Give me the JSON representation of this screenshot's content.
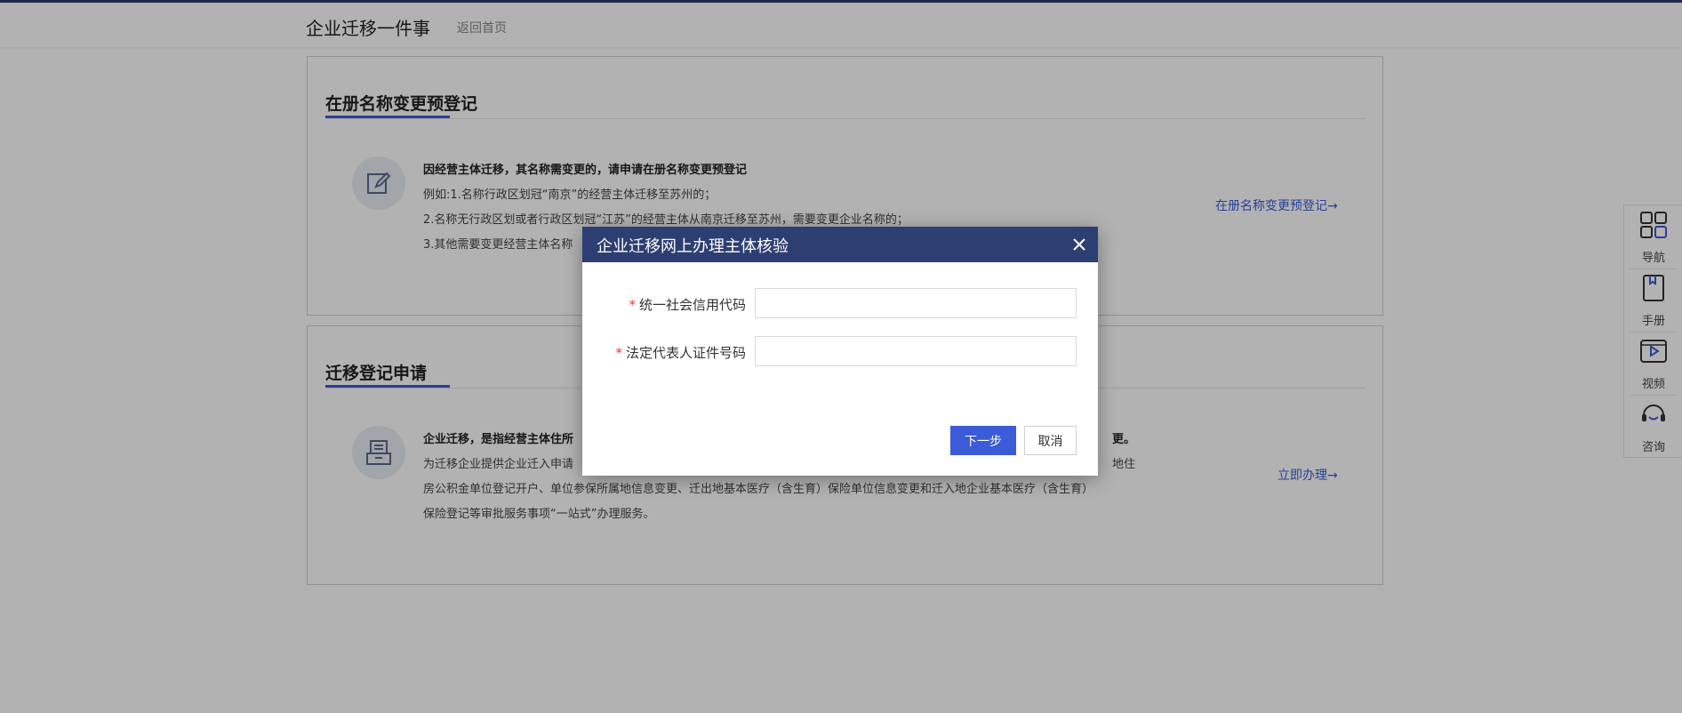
{
  "header": {
    "title": "企业迁移一件事",
    "home_link": "返回首页"
  },
  "cards": [
    {
      "title": "在册名称变更预登记",
      "lines": [
        "因经营主体迁移，其名称需变更的，请申请在册名称变更预登记",
        "例如:1.名称行政区划冠“南京”的经营主体迁移至苏州的；",
        "2.名称无行政区划或者行政区划冠“江苏”的经营主体从南京迁移至苏州，需要变更企业名称的；",
        "3.其他需要变更经营主体名称"
      ],
      "link": "在册名称变更预登记→",
      "icon": "edit-icon"
    },
    {
      "title": "迁移登记申请",
      "lines": [
        "企业迁移，是指经营主体住所",
        "为迁移企业提供企业迁入申请",
        "房公积金单位登记开户、单位参保所属地信息变更、迁出地基本医疗（含生育）保险单位信息变更和迁入地企业基本医疗（含生育）",
        "保险登记等审批服务事项“一站式”办理服务。"
      ],
      "line1_tail": "更。",
      "line2_tail": "地住",
      "link": "立即办理→",
      "icon": "form-icon"
    }
  ],
  "sidebar": {
    "items": [
      {
        "label": "导航",
        "icon": "grid-icon"
      },
      {
        "label": "手册",
        "icon": "book-icon"
      },
      {
        "label": "视频",
        "icon": "video-icon"
      },
      {
        "label": "咨询",
        "icon": "headset-icon"
      }
    ]
  },
  "modal": {
    "title": "企业迁移网上办理主体核验",
    "required_mark": "*",
    "field1_label": "统一社会信用代码",
    "field1_value": "",
    "field2_label": "法定代表人证件号码",
    "field2_value": "",
    "next_button": "下一步",
    "cancel_button": "取消"
  },
  "colors": {
    "accent": "#3b5bd9",
    "modal_header": "#2d3e72",
    "required": "#e53935"
  }
}
